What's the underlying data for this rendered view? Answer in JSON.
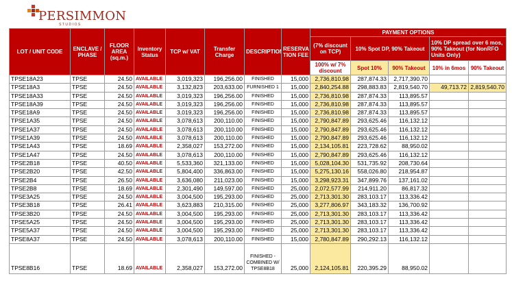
{
  "logo": {
    "text": "PERSIMMON",
    "sub": "STUDIOS"
  },
  "headers": {
    "lot": "LOT / UNIT CODE",
    "enclave": "ENCLAVE / PHASE",
    "floor": "FLOOR AREA (sq.m.)",
    "inventory": "Inventory Status",
    "tcp": "TCP w/ VAT",
    "transfer": "Transfer Charge",
    "description": "DESCRIPTION",
    "reservation": "RESERVA TION FEE",
    "payment_options": "PAYMENT OPTIONS",
    "discount": "(7% discount on TCP)",
    "spot10": "10% Spot DP, 90% Takeout",
    "spread": "10% DP spread over 6 mos, 90% Takeout (for NonRFO Units Only)",
    "sub_discount": "100% w/ 7% discount",
    "sub_spot": "Spot 10%",
    "sub_takeout": "90% Takeout",
    "sub_6mos": "10% in 6mos",
    "sub_takeout2": "90% Takeout"
  },
  "rows": [
    {
      "lot": "TPSE18A23",
      "enc": "TPSE",
      "area": "24.50",
      "status": "AVAILABLE",
      "tcp": "3,019,323",
      "transfer": "196,256.00",
      "desc": "FINISHED",
      "res": "15,000",
      "disc": "2,736,810.98",
      "spot": "287,874.33",
      "takeout": "2,717,390.70",
      "mos6": "",
      "takeout2": ""
    },
    {
      "lot": "TPSE18A3",
      "enc": "TPSE",
      "area": "24.50",
      "status": "AVAILABLE",
      "tcp": "3,132,823",
      "transfer": "203,633.00",
      "desc": "FURNISHED 1",
      "res": "15,000",
      "disc": "2,840,254.88",
      "spot": "298,883.83",
      "takeout": "2,819,540.70",
      "mos6": "49,713.72",
      "takeout2": "2,819,540.70"
    },
    {
      "lot": "TPSE18A33",
      "enc": "TPSE",
      "area": "24.50",
      "status": "AVAILABLE",
      "tcp": "3,019,323",
      "transfer": "196,256.00",
      "desc": "FINISHED",
      "res": "15,000",
      "disc": "2,736,810.98",
      "spot": "287,874.33",
      "takeout": "113,895.57",
      "mos6": "",
      "takeout2": ""
    },
    {
      "lot": "TPSE18A39",
      "enc": "TPSE",
      "area": "24.50",
      "status": "AVAILABLE",
      "tcp": "3,019,323",
      "transfer": "196,256.00",
      "desc": "FINISHED",
      "res": "15,000",
      "disc": "2,736,810.98",
      "spot": "287,874.33",
      "takeout": "113,895.57",
      "mos6": "",
      "takeout2": ""
    },
    {
      "lot": "TPSE18A9",
      "enc": "TPSE",
      "area": "24.50",
      "status": "AVAILABLE",
      "tcp": "3,019,323",
      "transfer": "196,256.00",
      "desc": "FINISHED",
      "res": "15,000",
      "disc": "2,736,810.98",
      "spot": "287,874.33",
      "takeout": "113,895.57",
      "mos6": "",
      "takeout2": ""
    },
    {
      "lot": "TPSE1A35",
      "enc": "TPSE",
      "area": "24.50",
      "status": "AVAILABLE",
      "tcp": "3,078,613",
      "transfer": "200,110.00",
      "desc": "FINISHED",
      "res": "15,000",
      "disc": "2,790,847.89",
      "spot": "293,625.46",
      "takeout": "116,132.12",
      "mos6": "",
      "takeout2": ""
    },
    {
      "lot": "TPSE1A37",
      "enc": "TPSE",
      "area": "24.50",
      "status": "AVAILABLE",
      "tcp": "3,078,613",
      "transfer": "200,110.00",
      "desc": "FINISHED",
      "res": "15,000",
      "disc": "2,790,847.89",
      "spot": "293,625.46",
      "takeout": "116,132.12",
      "mos6": "",
      "takeout2": ""
    },
    {
      "lot": "TPSE1A39",
      "enc": "TPSE",
      "area": "24.50",
      "status": "AVAILABLE",
      "tcp": "3,078,613",
      "transfer": "200,110.00",
      "desc": "FINISHED",
      "res": "15,000",
      "disc": "2,790,847.89",
      "spot": "293,625.46",
      "takeout": "116,132.12",
      "mos6": "",
      "takeout2": ""
    },
    {
      "lot": "TPSE1A43",
      "enc": "TPSE",
      "area": "18.69",
      "status": "AVAILABLE",
      "tcp": "2,358,027",
      "transfer": "153,272.00",
      "desc": "FINISHED",
      "res": "15,000",
      "disc": "2,134,105.81",
      "spot": "223,728.62",
      "takeout": "88,950.02",
      "mos6": "",
      "takeout2": ""
    },
    {
      "lot": "TPSE1A47",
      "enc": "TPSE",
      "area": "24.50",
      "status": "AVAILABLE",
      "tcp": "3,078,613",
      "transfer": "200,110.00",
      "desc": "FINISHED",
      "res": "15,000",
      "disc": "2,790,847.89",
      "spot": "293,625.46",
      "takeout": "116,132.12",
      "mos6": "",
      "takeout2": ""
    },
    {
      "lot": "TPSE2B18",
      "enc": "TPSE",
      "area": "40.50",
      "status": "AVAILABLE",
      "tcp": "5,533,360",
      "transfer": "321,133.00",
      "desc": "FINISHED",
      "res": "15,000",
      "disc": "5,028,104.30",
      "spot": "531,735.92",
      "takeout": "208,730.64",
      "mos6": "",
      "takeout2": ""
    },
    {
      "lot": "TPSE2B20",
      "enc": "TPSE",
      "area": "42.50",
      "status": "AVAILABLE",
      "tcp": "5,804,400",
      "transfer": "336,863.00",
      "desc": "FINISHED",
      "res": "15,000",
      "disc": "5,275,130.16",
      "spot": "558,026.80",
      "takeout": "218,954.87",
      "mos6": "",
      "takeout2": ""
    },
    {
      "lot": "TPSE2B4",
      "enc": "TPSE",
      "area": "26.50",
      "status": "AVAILABLE",
      "tcp": "3,636,080",
      "transfer": "211,023.00",
      "desc": "FINISHED",
      "res": "15,000",
      "disc": "3,298,923.31",
      "spot": "347,899.76",
      "takeout": "137,161.02",
      "mos6": "",
      "takeout2": ""
    },
    {
      "lot": "TPSE2B8",
      "enc": "TPSE",
      "area": "18.69",
      "status": "AVAILABLE",
      "tcp": "2,301,490",
      "transfer": "149,597.00",
      "desc": "FINISHED",
      "res": "25,000",
      "disc": "2,072,577.99",
      "spot": "214,911.20",
      "takeout": "86,817.32",
      "mos6": "",
      "takeout2": ""
    },
    {
      "lot": "TPSE3A25",
      "enc": "TPSE",
      "area": "24.50",
      "status": "AVAILABLE",
      "tcp": "3,004,500",
      "transfer": "195,293.00",
      "desc": "FINISHED",
      "res": "25,000",
      "disc": "2,713,301.30",
      "spot": "283,103.17",
      "takeout": "113,336.42",
      "mos6": "",
      "takeout2": ""
    },
    {
      "lot": "TPSE3B18",
      "enc": "TPSE",
      "area": "26.41",
      "status": "AVAILABLE",
      "tcp": "3,623,883",
      "transfer": "210,315.00",
      "desc": "FINISHED",
      "res": "25,000",
      "disc": "3,277,806.97",
      "spot": "343,183.32",
      "takeout": "136,700.92",
      "mos6": "",
      "takeout2": ""
    },
    {
      "lot": "TPSE3B20",
      "enc": "TPSE",
      "area": "24.50",
      "status": "AVAILABLE",
      "tcp": "3,004,500",
      "transfer": "195,293.00",
      "desc": "FINISHED",
      "res": "25,000",
      "disc": "2,713,301.30",
      "spot": "283,103.17",
      "takeout": "113,336.42",
      "mos6": "",
      "takeout2": ""
    },
    {
      "lot": "TPSE5A25",
      "enc": "TPSE",
      "area": "24.50",
      "status": "AVAILABLE",
      "tcp": "3,004,500",
      "transfer": "195,293.00",
      "desc": "FINISHED",
      "res": "25,000",
      "disc": "2,713,301.30",
      "spot": "283,103.17",
      "takeout": "113,336.42",
      "mos6": "",
      "takeout2": ""
    },
    {
      "lot": "TPSE5A37",
      "enc": "TPSE",
      "area": "24.50",
      "status": "AVAILABLE",
      "tcp": "3,004,500",
      "transfer": "195,293.00",
      "desc": "FINISHED",
      "res": "25,000",
      "disc": "2,713,301.30",
      "spot": "283,103.17",
      "takeout": "113,336.42",
      "mos6": "",
      "takeout2": ""
    },
    {
      "lot": "TPSE8A37",
      "enc": "TPSE",
      "area": "24.50",
      "status": "AVAILABLE",
      "tcp": "3,078,613",
      "transfer": "200,110.00",
      "desc": "FINISHED",
      "res": "15,000",
      "disc": "2,780,847.89",
      "spot": "290,292.13",
      "takeout": "116,132.12",
      "mos6": "",
      "takeout2": ""
    },
    {
      "lot": "TPSE8B16",
      "enc": "TPSE",
      "area": "18.69",
      "status": "AVAILABLE",
      "tcp": "2,358,027",
      "transfer": "153,272.00",
      "desc": "FINISHED - COMBINED W/ TPSE8B18",
      "res": "25,000",
      "disc": "2,124,105.81",
      "spot": "220,395.29",
      "takeout": "88,950.02",
      "mos6": "",
      "takeout2": ""
    }
  ],
  "colors": {
    "header_red": "#c00000",
    "highlight_yellow": "#fce9a0",
    "brand": "#9c2a1f"
  }
}
